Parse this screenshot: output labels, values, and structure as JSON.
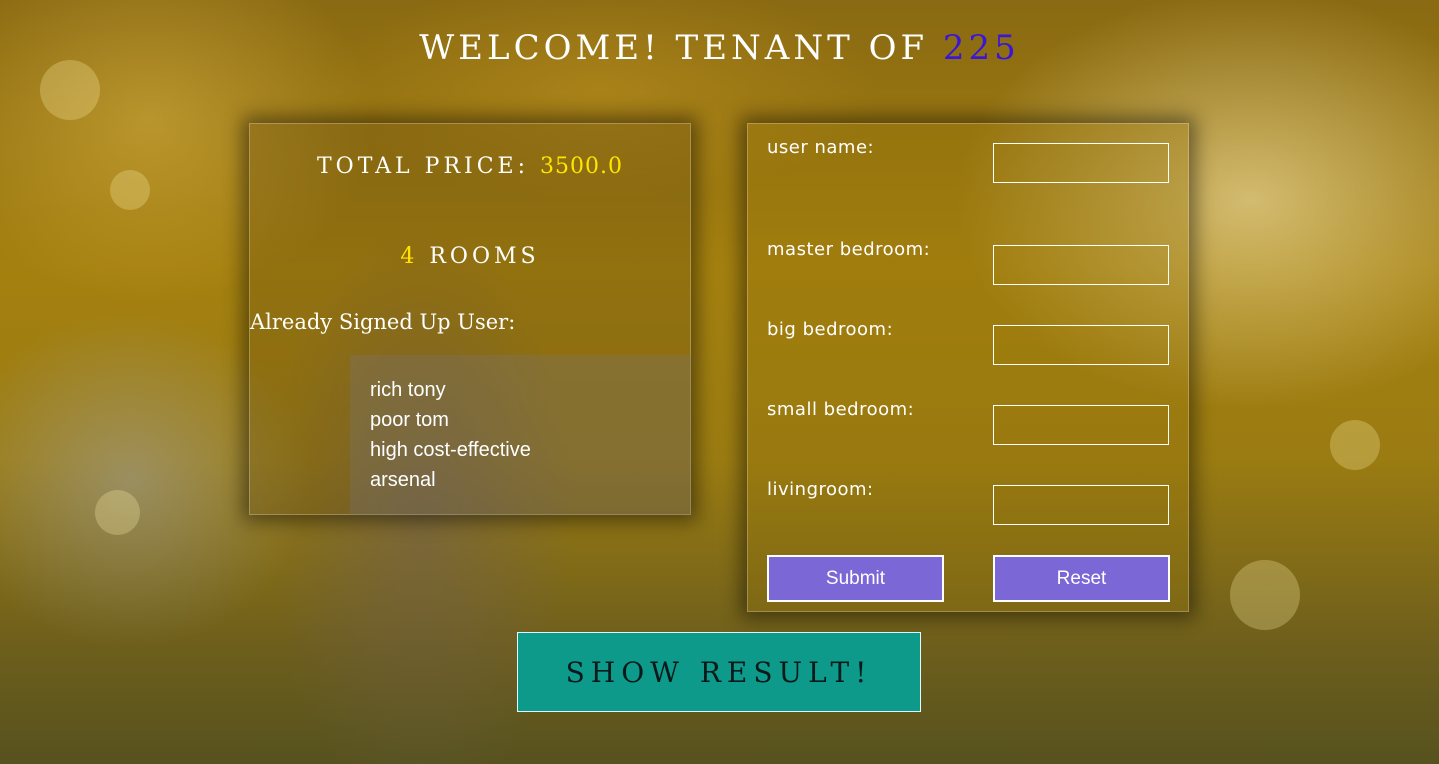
{
  "header": {
    "title_prefix": "WELCOME! TENANT OF ",
    "title_room": "225",
    "accent_color": "#3a16d8"
  },
  "summary": {
    "price_label": "TOTAL PRICE: ",
    "price_value": "3500.0",
    "rooms_count": "4",
    "rooms_label": " ROOMS",
    "signed_heading": "Already Signed Up User:",
    "highlight_color": "#ffe600",
    "users": [
      "rich tony",
      "poor tom",
      "high cost-effective",
      "arsenal"
    ]
  },
  "form": {
    "fields": [
      {
        "label": "user name:",
        "value": ""
      },
      {
        "label": "master bedroom:",
        "value": ""
      },
      {
        "label": "big bedroom:",
        "value": ""
      },
      {
        "label": "small bedroom:",
        "value": ""
      },
      {
        "label": "livingroom:",
        "value": ""
      }
    ],
    "submit_label": "Submit",
    "reset_label": "Reset",
    "button_color": "#7b68d6"
  },
  "actions": {
    "show_result_label": "SHOW RESULT!",
    "show_result_color": "#0d9a8b"
  }
}
